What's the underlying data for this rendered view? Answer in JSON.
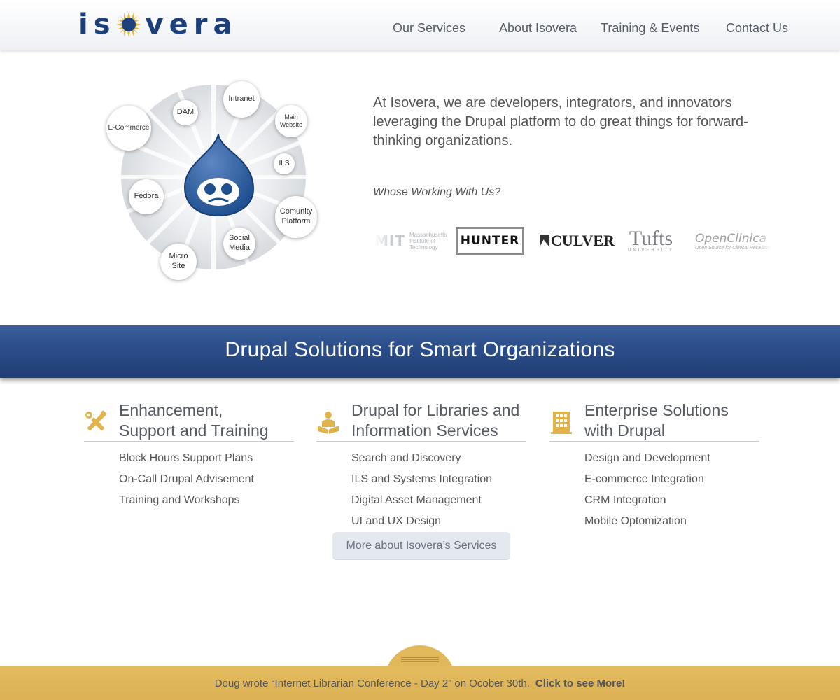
{
  "brand": {
    "logo_text_left": "is",
    "logo_text_right": "vera",
    "accent": "#1d3f7a",
    "sun": "#e8b93a"
  },
  "nav": {
    "items": [
      {
        "label": "Our Services"
      },
      {
        "label": "About Isovera"
      },
      {
        "label": "Training & Events"
      },
      {
        "label": "Contact Us"
      }
    ]
  },
  "hero": {
    "bubbles": {
      "ecommerce": "E-Commerce",
      "dam": "DAM",
      "intranet": "Intranet",
      "main_website": "Main Website",
      "ils": "ILS",
      "fedora": "Fedora",
      "community": "Comunity Platform",
      "social": "Social Media",
      "micro": "Micro Site"
    },
    "tagline": "At Isovera, we are developers, integrators, and innovators leveraging the Drupal platform to do great things for forward-thinking organizations.",
    "working_heading": "Whose Working With Us?",
    "clients": {
      "mit_mark": "MIT",
      "mit_name": "Massachusetts Institute of Technology",
      "hunter": "HUNTER",
      "culver": "CULVER",
      "tufts": "Tufts",
      "tufts_sub": "UNIVERSITY",
      "openclinica": "OpenClinica",
      "openclinica_sub": "Open Source for Clinical Research"
    }
  },
  "banner": {
    "title": "Drupal Solutions for Smart Organizations"
  },
  "columns": [
    {
      "icon": "tools-icon",
      "title_line1": "Enhancement,",
      "title_line2": "Support and Training",
      "items": [
        "Block Hours Support Plans",
        "On-Call Drupal Advisement",
        "Training and Workshops"
      ]
    },
    {
      "icon": "reader-icon",
      "title_line1": "Drupal for Libraries and",
      "title_line2": "Information Services",
      "items": [
        "Search and Discovery",
        "ILS and Systems Integration",
        "Digital Asset Management",
        "UI and UX Design"
      ]
    },
    {
      "icon": "building-icon",
      "title_line1": "Enterprise Solutions",
      "title_line2": "with Drupal",
      "items": [
        "Design and Development",
        "E-commerce Integration",
        "CRM Integration",
        "Mobile Optomization"
      ]
    }
  ],
  "more_button": "More about Isovera’s Services",
  "footer": {
    "news": "Doug wrote “Internet Librarian Conference - Day 2” on Ocober 30th.",
    "cta": "Click to see More!"
  },
  "colors": {
    "banner_blue": "#2a4d8a",
    "gold": "#e2b85a",
    "icon_gold": "#e0b44a"
  }
}
